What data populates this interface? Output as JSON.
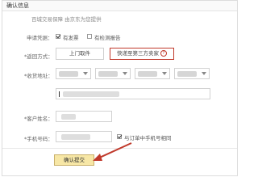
{
  "header": {
    "title": "确认信息"
  },
  "notice": "百城交易保障 由京东为您提供",
  "apply": {
    "label": "申请凭据：",
    "options": [
      {
        "label": "有发票",
        "checked": true
      },
      {
        "label": "有检测报告",
        "checked": false
      }
    ]
  },
  "return_method": {
    "label": "*返回方式：",
    "options": [
      {
        "label": "上门取件",
        "selected": false
      },
      {
        "label": "快递至第三方卖家",
        "selected": true
      }
    ],
    "help": "?"
  },
  "pickup_address": {
    "label": "*收货地址："
  },
  "contact": {
    "label": "*客户姓名："
  },
  "phone": {
    "label": "*手机号码：",
    "same_as_order": {
      "label": "与订单中手机号相同",
      "checked": true
    }
  },
  "submit": {
    "label": "确认提交"
  },
  "colors": {
    "accent": "#c0392b",
    "submit_bg": "#f7e7a6",
    "arrow": "#c0392b"
  }
}
